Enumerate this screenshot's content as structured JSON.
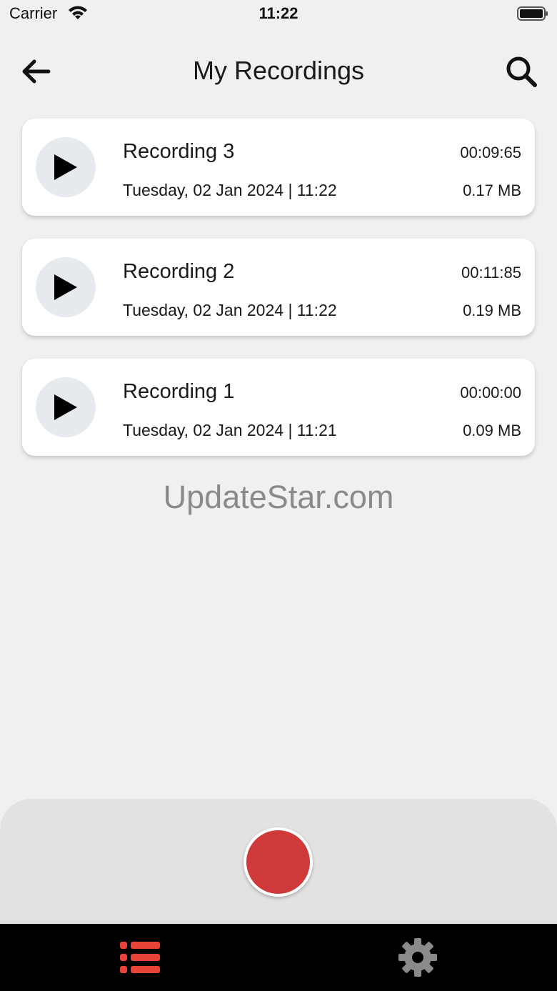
{
  "status_bar": {
    "carrier": "Carrier",
    "time": "11:22",
    "wifi_icon": "wifi-icon",
    "battery_icon": "battery-full-icon"
  },
  "header": {
    "title": "My Recordings",
    "back_icon": "arrow-left-icon",
    "search_icon": "search-icon"
  },
  "recordings": [
    {
      "name": "Recording 3",
      "date": "Tuesday, 02 Jan 2024 | 11:22",
      "duration": "00:09:65",
      "size": "0.17 MB"
    },
    {
      "name": "Recording 2",
      "date": "Tuesday, 02 Jan 2024 | 11:22",
      "duration": "00:11:85",
      "size": "0.19 MB"
    },
    {
      "name": "Recording 1",
      "date": "Tuesday, 02 Jan 2024 | 11:21",
      "duration": "00:00:00",
      "size": "0.09 MB"
    }
  ],
  "watermark": "UpdateStar.com",
  "record_button": {
    "icon": "record-icon"
  },
  "tab_bar": {
    "tabs": [
      {
        "name": "recordings-list",
        "icon": "list-icon",
        "active": true
      },
      {
        "name": "settings",
        "icon": "gear-icon",
        "active": false
      }
    ]
  },
  "colors": {
    "accent": "#e84438",
    "record": "#d0393a",
    "inactive_tab": "#8a8a8a",
    "background": "#f0f0f0",
    "play_circle": "#e6e9ee"
  }
}
